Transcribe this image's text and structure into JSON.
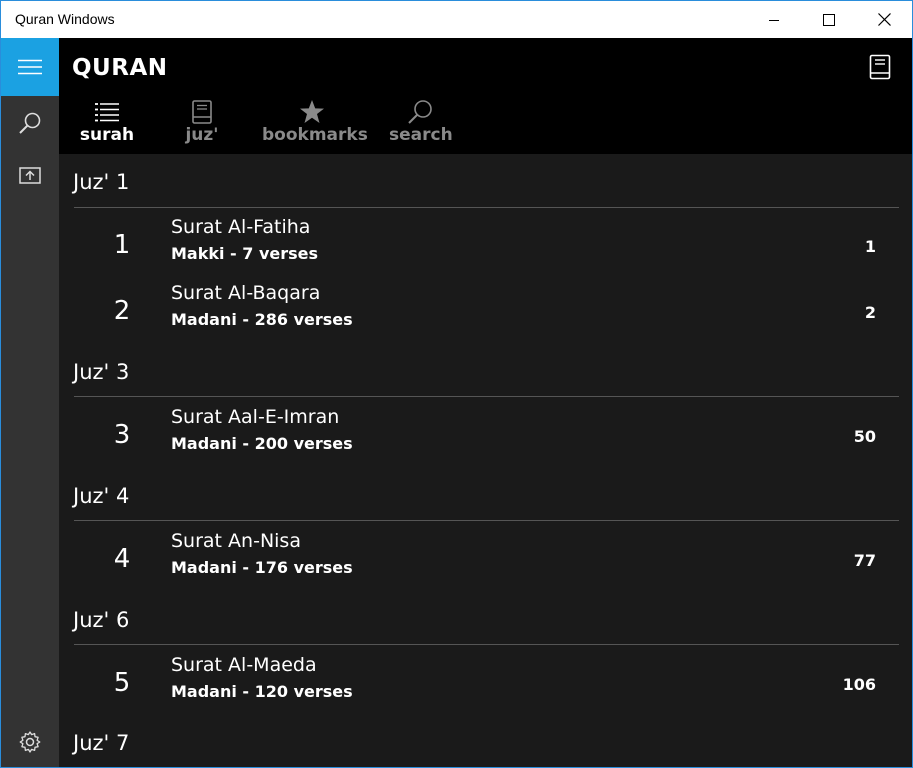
{
  "window": {
    "title": "Quran Windows"
  },
  "app": {
    "title": "QURAN"
  },
  "tabs": [
    {
      "label": "surah",
      "icon": "list-icon"
    },
    {
      "label": "juz'",
      "icon": "book-icon"
    },
    {
      "label": "bookmarks",
      "icon": "star-icon"
    },
    {
      "label": "search",
      "icon": "search-icon"
    }
  ],
  "colors": {
    "accent": "#1ba1e2",
    "background": "#1a1a1a",
    "header": "#000000",
    "sidebar": "#333333"
  },
  "groups": [
    {
      "header": "Juz' 1",
      "items": [
        {
          "number": "1",
          "name": "Surat Al-Fatiha",
          "meta": "Makki -  7 verses",
          "page": "1"
        },
        {
          "number": "2",
          "name": "Surat Al-Baqara",
          "meta": "Madani -  286 verses",
          "page": "2"
        }
      ]
    },
    {
      "header": "Juz' 3",
      "items": [
        {
          "number": "3",
          "name": "Surat Aal-E-Imran",
          "meta": "Madani -  200 verses",
          "page": "50"
        }
      ]
    },
    {
      "header": "Juz' 4",
      "items": [
        {
          "number": "4",
          "name": "Surat An-Nisa",
          "meta": "Madani -  176 verses",
          "page": "77"
        }
      ]
    },
    {
      "header": "Juz' 6",
      "items": [
        {
          "number": "5",
          "name": "Surat Al-Maeda",
          "meta": "Madani -  120 verses",
          "page": "106"
        }
      ]
    },
    {
      "header": "Juz' 7",
      "items": []
    }
  ]
}
